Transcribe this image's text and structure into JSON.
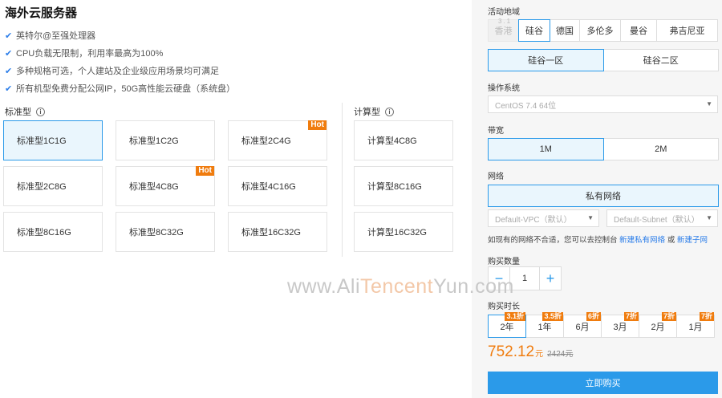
{
  "header": {
    "title": "海外云服务器"
  },
  "features": [
    "英特尔@至强处理器",
    "CPU负载无限制，利用率最高为100%",
    "多种规格可选，个人建站及企业级应用场景均可满足",
    "所有机型免费分配公网IP，50G高性能云硬盘（系统盘）"
  ],
  "standard": {
    "label": "标准型",
    "cards": [
      {
        "label": "标准型1C1G",
        "hot": "",
        "selected": true
      },
      {
        "label": "标准型1C2G",
        "hot": "",
        "selected": false
      },
      {
        "label": "标准型2C4G",
        "hot": "Hot",
        "selected": false
      },
      {
        "label": "标准型2C8G",
        "hot": "",
        "selected": false
      },
      {
        "label": "标准型4C8G",
        "hot": "Hot",
        "selected": false
      },
      {
        "label": "标准型4C16G",
        "hot": "",
        "selected": false
      },
      {
        "label": "标准型8C16G",
        "hot": "",
        "selected": false
      },
      {
        "label": "标准型8C32G",
        "hot": "",
        "selected": false
      },
      {
        "label": "标准型16C32G",
        "hot": "",
        "selected": false
      }
    ]
  },
  "compute": {
    "label": "计算型",
    "cards": [
      {
        "label": "计算型4C8G"
      },
      {
        "label": "计算型8C16G"
      },
      {
        "label": "计算型16C32G"
      }
    ]
  },
  "region": {
    "label": "活动地域",
    "disabled_badge": "3.1",
    "items": [
      {
        "label": "香港",
        "state": "disabled"
      },
      {
        "label": "硅谷",
        "state": "selected"
      },
      {
        "label": "德国",
        "state": ""
      },
      {
        "label": "多伦多",
        "state": ""
      },
      {
        "label": "曼谷",
        "state": ""
      },
      {
        "label": "弗吉尼亚",
        "state": ""
      }
    ]
  },
  "zones": [
    {
      "label": "硅谷一区",
      "selected": true
    },
    {
      "label": "硅谷二区",
      "selected": false
    }
  ],
  "os": {
    "label": "操作系统",
    "value": "CentOS 7.4 64位"
  },
  "bandwidth": {
    "label": "带宽",
    "options": [
      {
        "label": "1M",
        "selected": true
      },
      {
        "label": "2M",
        "selected": false
      }
    ]
  },
  "network": {
    "label": "网络",
    "type": "私有网络",
    "vpc": "Default-VPC（默认）",
    "subnet": "Default-Subnet（默认）",
    "hint_prefix": "如现有的网络不合适，您可以去控制台",
    "link_vpc": "新建私有网络",
    "hint_or": "或",
    "link_subnet": "新建子网"
  },
  "quantity": {
    "label": "购买数量",
    "value": "1",
    "minus": "−",
    "plus": "+"
  },
  "duration": {
    "label": "购买时长",
    "options": [
      {
        "label": "2年",
        "discount": "3.1折",
        "selected": true
      },
      {
        "label": "1年",
        "discount": "3.5折",
        "selected": false
      },
      {
        "label": "6月",
        "discount": "6折",
        "selected": false
      },
      {
        "label": "3月",
        "discount": "7折",
        "selected": false
      },
      {
        "label": "2月",
        "discount": "7折",
        "selected": false
      },
      {
        "label": "1月",
        "discount": "7折",
        "selected": false
      }
    ]
  },
  "price": {
    "value": "752.12",
    "unit": "元",
    "original": "2424元"
  },
  "buy_label": "立即购买",
  "watermark": {
    "a": "www.Ali",
    "b": "Tencent",
    "c": "Yun.com"
  },
  "info_glyph": "i",
  "check_glyph": "✔",
  "chevron_glyph": "▼",
  "colors": {
    "accent": "#2b9ae9",
    "hot": "#f07c0e",
    "selected_bg": "#eaf6fd"
  }
}
